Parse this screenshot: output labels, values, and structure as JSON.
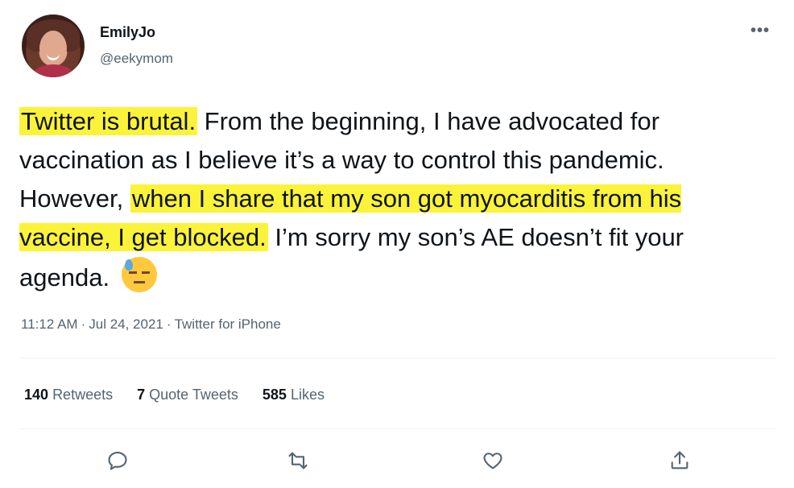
{
  "user": {
    "display_name": "EmilyJo",
    "handle": "@eekymom"
  },
  "more_label": "•••",
  "tweet": {
    "hl1": "Twitter is brutal.",
    "t1": " From the beginning, I have advocated for vaccination as I believe it’s a way to control this pandemic. However, ",
    "hl2": "when I share that my son got myocarditis from his vaccine, I get blocked.",
    "t2": " I’m sorry my son’s AE doesn’t fit your agenda. ",
    "emoji": "downcast-face-with-sweat"
  },
  "meta": {
    "time": "11:12 AM",
    "date": "Jul 24, 2021",
    "source": "Twitter for iPhone",
    "sep": "·"
  },
  "stats": {
    "retweets_count": "140",
    "retweets_label": "Retweets",
    "quotes_count": "7",
    "quotes_label": "Quote Tweets",
    "likes_count": "585",
    "likes_label": "Likes"
  },
  "actions": [
    "reply-icon",
    "retweet-icon",
    "like-icon",
    "share-icon"
  ],
  "colors": {
    "highlight": "#fbf33a",
    "secondary_text": "#536471",
    "icon": "#536471"
  }
}
